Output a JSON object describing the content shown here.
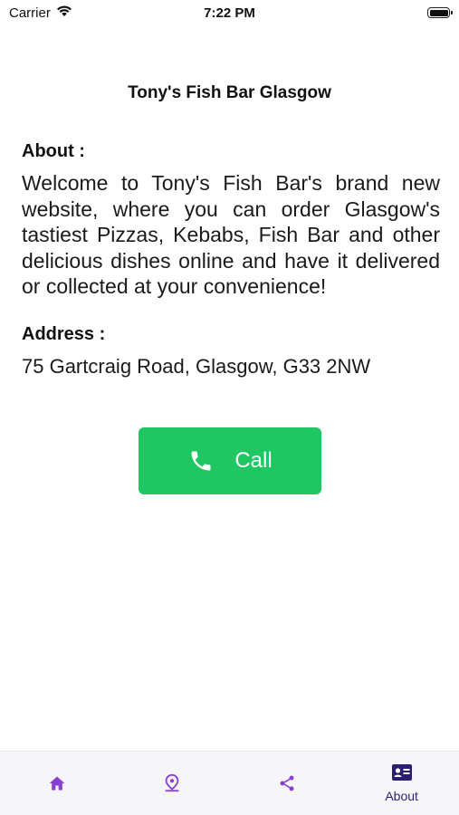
{
  "status_bar": {
    "carrier": "Carrier",
    "time": "7:22 PM",
    "battery_level": 1.0
  },
  "page": {
    "title": "Tony's Fish Bar Glasgow"
  },
  "about": {
    "heading": "About :",
    "text": "Welcome to Tony's Fish Bar's brand new website, where you can order Glasgow's tastiest Pizzas, Kebabs, Fish Bar and other delicious dishes online and have it delivered or collected at your convenience!"
  },
  "address": {
    "heading": "Address :",
    "text": "75 Gartcraig Road, Glasgow, G33 2NW"
  },
  "call_button": {
    "label": "Call",
    "icon": "phone-icon",
    "color": "#1ec761"
  },
  "tab_bar": {
    "accent_color": "#8a3fd1",
    "active_color": "#2c1d73",
    "tabs": [
      {
        "icon": "home-icon",
        "label": ""
      },
      {
        "icon": "map-pin-icon",
        "label": ""
      },
      {
        "icon": "share-icon",
        "label": ""
      },
      {
        "icon": "contact-card-icon",
        "label": "About",
        "active": true
      }
    ]
  }
}
